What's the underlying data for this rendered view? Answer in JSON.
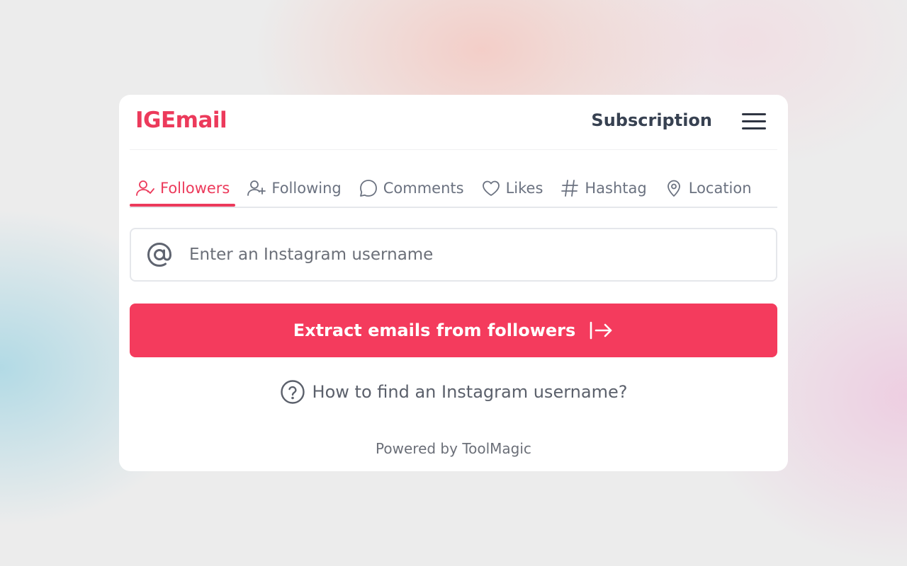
{
  "header": {
    "brand": "IGEmail",
    "subscription_label": "Subscription",
    "menu_icon": "hamburger-menu-icon"
  },
  "tabs": [
    {
      "label": "Followers",
      "icon": "user-check-icon",
      "active": true
    },
    {
      "label": "Following",
      "icon": "user-plus-icon",
      "active": false
    },
    {
      "label": "Comments",
      "icon": "comment-bubble-icon",
      "active": false
    },
    {
      "label": "Likes",
      "icon": "heart-icon",
      "active": false
    },
    {
      "label": "Hashtag",
      "icon": "hashtag-icon",
      "active": false
    },
    {
      "label": "Location",
      "icon": "map-pin-icon",
      "active": false
    }
  ],
  "search": {
    "icon": "at-sign-icon",
    "placeholder": "Enter an Instagram username",
    "value": ""
  },
  "extract_button": {
    "label": "Extract emails from followers",
    "icon": "arrow-right-to-bar-icon"
  },
  "help": {
    "icon": "question-circle-icon",
    "label": "How to find an Instagram username?"
  },
  "footer": {
    "text": "Powered by ToolMagic"
  },
  "colors": {
    "accent": "#ec3a5b",
    "button": "#f43b5d",
    "text_dark": "#374151",
    "text_muted": "#6b7280"
  }
}
